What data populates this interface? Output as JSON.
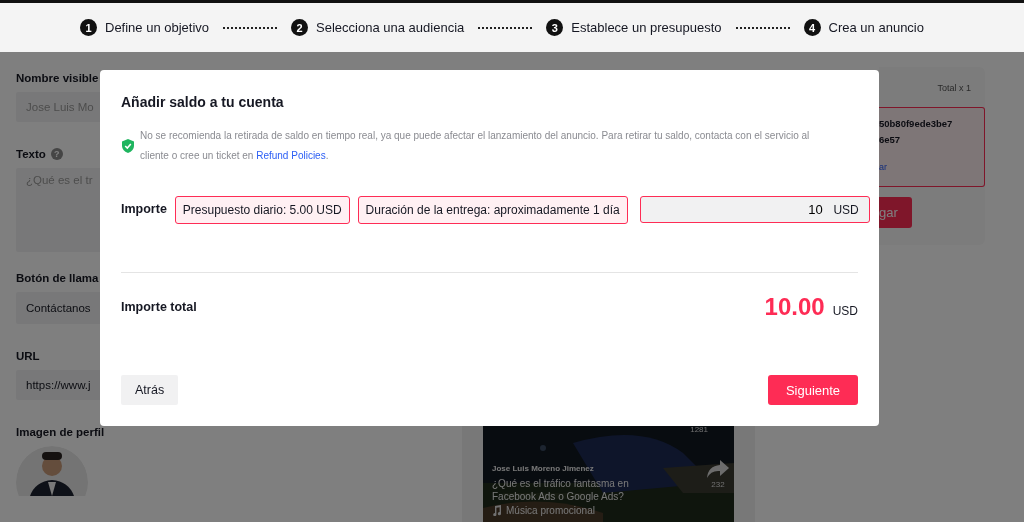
{
  "stepper": {
    "steps": [
      {
        "number": "1",
        "label": "Define un objetivo"
      },
      {
        "number": "2",
        "label": "Selecciona una audiencia"
      },
      {
        "number": "3",
        "label": "Establece un presupuesto"
      },
      {
        "number": "4",
        "label": "Crea un anuncio"
      }
    ]
  },
  "form": {
    "fields": [
      {
        "kind": "input",
        "label": "Nombre visible",
        "value": "Jose Luis Mo",
        "disabled": true
      },
      {
        "kind": "textarea",
        "label": "Texto",
        "help": "?",
        "placeholder": "¿Qué es el tr"
      },
      {
        "kind": "select",
        "label": "Botón de llama",
        "value": "Contáctanos"
      },
      {
        "kind": "input",
        "label": "URL",
        "value": "https://www.j"
      },
      {
        "kind": "avatar",
        "label": "Imagen de perfil"
      }
    ]
  },
  "summary_card": {
    "total": "Total x 1",
    "id_lines": [
      "50b80f9ede3be7",
      "6e57"
    ],
    "link": "ar",
    "button": "gar"
  },
  "preview": {
    "likes": "1281",
    "author": "Jose Luis Moreno Jimenez",
    "caption": "¿Qué es el tráfico fantasma en Facebook Ads o Google Ads?",
    "music": "Música promocional",
    "shares": "232"
  },
  "dialog": {
    "title": "Añadir saldo a tu cuenta",
    "notice": "No se recomienda la retirada de saldo en tiempo real, ya que puede afectar el lanzamiento del anuncio. Para retirar tu saldo, contacta con el servicio al cliente o cree un ticket en ",
    "notice_link": "Refund Policies",
    "notice_end": ".",
    "amount": {
      "label": "Importe",
      "chips": [
        "Presupuesto diario: 5.00 USD",
        "Duración de la entrega: aproximadamente 1 día"
      ],
      "value": "10",
      "currency": "USD"
    },
    "total": {
      "label": "Importe total",
      "value": "10.00",
      "currency": "USD"
    },
    "back_button": "Atrás",
    "next_button": "Siguiente"
  }
}
